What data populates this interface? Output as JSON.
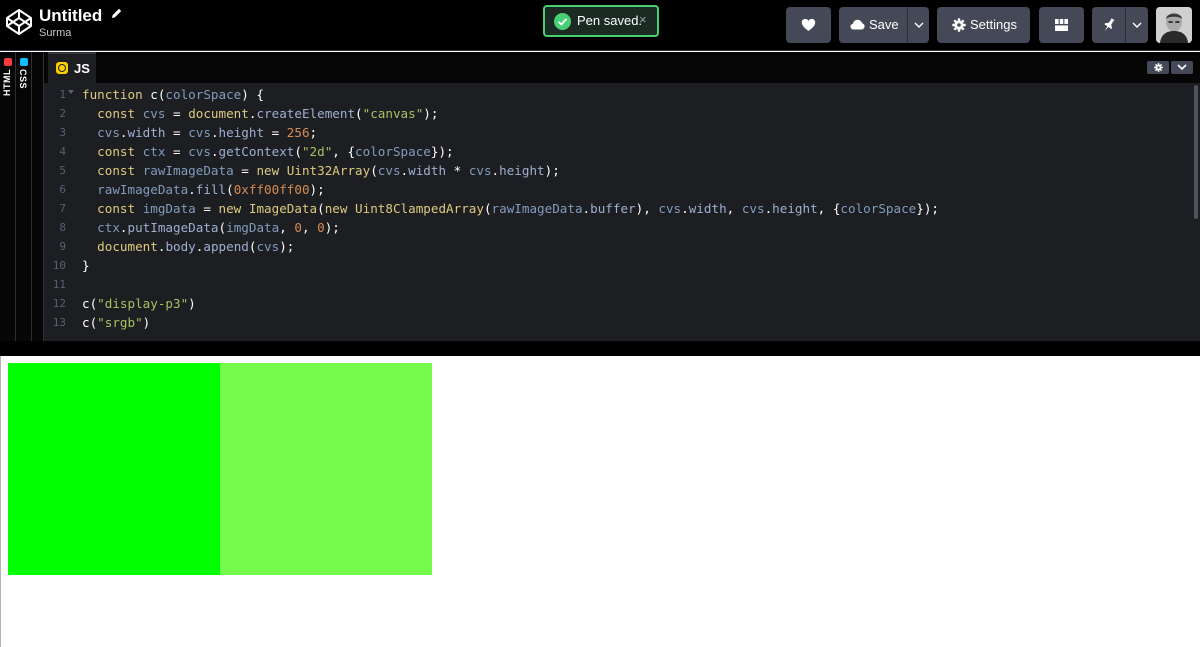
{
  "header": {
    "title": "Untitled",
    "author": "Surma",
    "toast": "Pen saved.",
    "toast_close": "×",
    "save_label": "Save",
    "settings_label": "Settings"
  },
  "sidebar": {
    "tabs": [
      {
        "label": "HTML",
        "color": "#ff3c41"
      },
      {
        "label": "CSS",
        "color": "#0ebeff"
      }
    ]
  },
  "editor": {
    "tab_label": "JS",
    "tab_color": "#fcd000",
    "lines": [
      {
        "n": "1",
        "tokens": [
          [
            "kw",
            "function"
          ],
          [
            "pn",
            " c("
          ],
          [
            "var",
            "colorSpace"
          ],
          [
            "pn",
            ") {"
          ]
        ]
      },
      {
        "n": "2",
        "tokens": [
          [
            "pn",
            "  "
          ],
          [
            "kw",
            "const"
          ],
          [
            "pn",
            " "
          ],
          [
            "var",
            "cvs"
          ],
          [
            "pn",
            " = "
          ],
          [
            "kw",
            "document"
          ],
          [
            "pn",
            "."
          ],
          [
            "prop",
            "createElement"
          ],
          [
            "pn",
            "("
          ],
          [
            "str",
            "\"canvas\""
          ],
          [
            "pn",
            ");"
          ]
        ]
      },
      {
        "n": "3",
        "tokens": [
          [
            "pn",
            "  "
          ],
          [
            "var",
            "cvs"
          ],
          [
            "pn",
            "."
          ],
          [
            "prop",
            "width"
          ],
          [
            "pn",
            " = "
          ],
          [
            "var",
            "cvs"
          ],
          [
            "pn",
            "."
          ],
          [
            "prop",
            "height"
          ],
          [
            "pn",
            " = "
          ],
          [
            "num",
            "256"
          ],
          [
            "pn",
            ";"
          ]
        ]
      },
      {
        "n": "4",
        "tokens": [
          [
            "pn",
            "  "
          ],
          [
            "kw",
            "const"
          ],
          [
            "pn",
            " "
          ],
          [
            "var",
            "ctx"
          ],
          [
            "pn",
            " = "
          ],
          [
            "var",
            "cvs"
          ],
          [
            "pn",
            "."
          ],
          [
            "prop",
            "getContext"
          ],
          [
            "pn",
            "("
          ],
          [
            "str",
            "\"2d\""
          ],
          [
            "pn",
            ", {"
          ],
          [
            "var",
            "colorSpace"
          ],
          [
            "pn",
            "});"
          ]
        ]
      },
      {
        "n": "5",
        "tokens": [
          [
            "pn",
            "  "
          ],
          [
            "kw",
            "const"
          ],
          [
            "pn",
            " "
          ],
          [
            "var",
            "rawImageData"
          ],
          [
            "pn",
            " = "
          ],
          [
            "kw",
            "new"
          ],
          [
            "pn",
            " "
          ],
          [
            "kw",
            "Uint32Array"
          ],
          [
            "pn",
            "("
          ],
          [
            "var",
            "cvs"
          ],
          [
            "pn",
            "."
          ],
          [
            "prop",
            "width"
          ],
          [
            "pn",
            " * "
          ],
          [
            "var",
            "cvs"
          ],
          [
            "pn",
            "."
          ],
          [
            "prop",
            "height"
          ],
          [
            "pn",
            ");"
          ]
        ]
      },
      {
        "n": "6",
        "tokens": [
          [
            "pn",
            "  "
          ],
          [
            "var",
            "rawImageData"
          ],
          [
            "pn",
            "."
          ],
          [
            "prop",
            "fill"
          ],
          [
            "pn",
            "("
          ],
          [
            "num",
            "0xff00ff00"
          ],
          [
            "pn",
            ");"
          ]
        ]
      },
      {
        "n": "7",
        "tokens": [
          [
            "pn",
            "  "
          ],
          [
            "kw",
            "const"
          ],
          [
            "pn",
            " "
          ],
          [
            "var",
            "imgData"
          ],
          [
            "pn",
            " = "
          ],
          [
            "kw",
            "new"
          ],
          [
            "pn",
            " "
          ],
          [
            "kw",
            "ImageData"
          ],
          [
            "pn",
            "("
          ],
          [
            "kw",
            "new"
          ],
          [
            "pn",
            " "
          ],
          [
            "kw",
            "Uint8ClampedArray"
          ],
          [
            "pn",
            "("
          ],
          [
            "var",
            "rawImageData"
          ],
          [
            "pn",
            "."
          ],
          [
            "prop",
            "buffer"
          ],
          [
            "pn",
            "), "
          ],
          [
            "var",
            "cvs"
          ],
          [
            "pn",
            "."
          ],
          [
            "prop",
            "width"
          ],
          [
            "pn",
            ", "
          ],
          [
            "var",
            "cvs"
          ],
          [
            "pn",
            "."
          ],
          [
            "prop",
            "height"
          ],
          [
            "pn",
            ", {"
          ],
          [
            "var",
            "colorSpace"
          ],
          [
            "pn",
            "});"
          ]
        ]
      },
      {
        "n": "8",
        "tokens": [
          [
            "pn",
            "  "
          ],
          [
            "var",
            "ctx"
          ],
          [
            "pn",
            "."
          ],
          [
            "prop",
            "putImageData"
          ],
          [
            "pn",
            "("
          ],
          [
            "var",
            "imgData"
          ],
          [
            "pn",
            ", "
          ],
          [
            "num",
            "0"
          ],
          [
            "pn",
            ", "
          ],
          [
            "num",
            "0"
          ],
          [
            "pn",
            ");"
          ]
        ]
      },
      {
        "n": "9",
        "tokens": [
          [
            "pn",
            "  "
          ],
          [
            "kw",
            "document"
          ],
          [
            "pn",
            "."
          ],
          [
            "prop",
            "body"
          ],
          [
            "pn",
            "."
          ],
          [
            "prop",
            "append"
          ],
          [
            "pn",
            "("
          ],
          [
            "var",
            "cvs"
          ],
          [
            "pn",
            ");"
          ]
        ]
      },
      {
        "n": "10",
        "tokens": [
          [
            "pn",
            "}"
          ]
        ]
      },
      {
        "n": "11",
        "tokens": []
      },
      {
        "n": "12",
        "tokens": [
          [
            "pn",
            "c("
          ],
          [
            "str",
            "\"display-p3\""
          ],
          [
            "pn",
            ")"
          ]
        ]
      },
      {
        "n": "13",
        "tokens": [
          [
            "pn",
            "c("
          ],
          [
            "str",
            "\"srgb\""
          ],
          [
            "pn",
            ")"
          ]
        ]
      }
    ]
  },
  "preview": {
    "canvases": [
      {
        "color_space": "display-p3",
        "fill": "#00ff00"
      },
      {
        "color_space": "srgb",
        "fill": "#75fb4c"
      }
    ]
  },
  "colors": {
    "accent_green": "#47cf73",
    "button_bg": "#444857",
    "editor_bg": "#1d1e22"
  }
}
